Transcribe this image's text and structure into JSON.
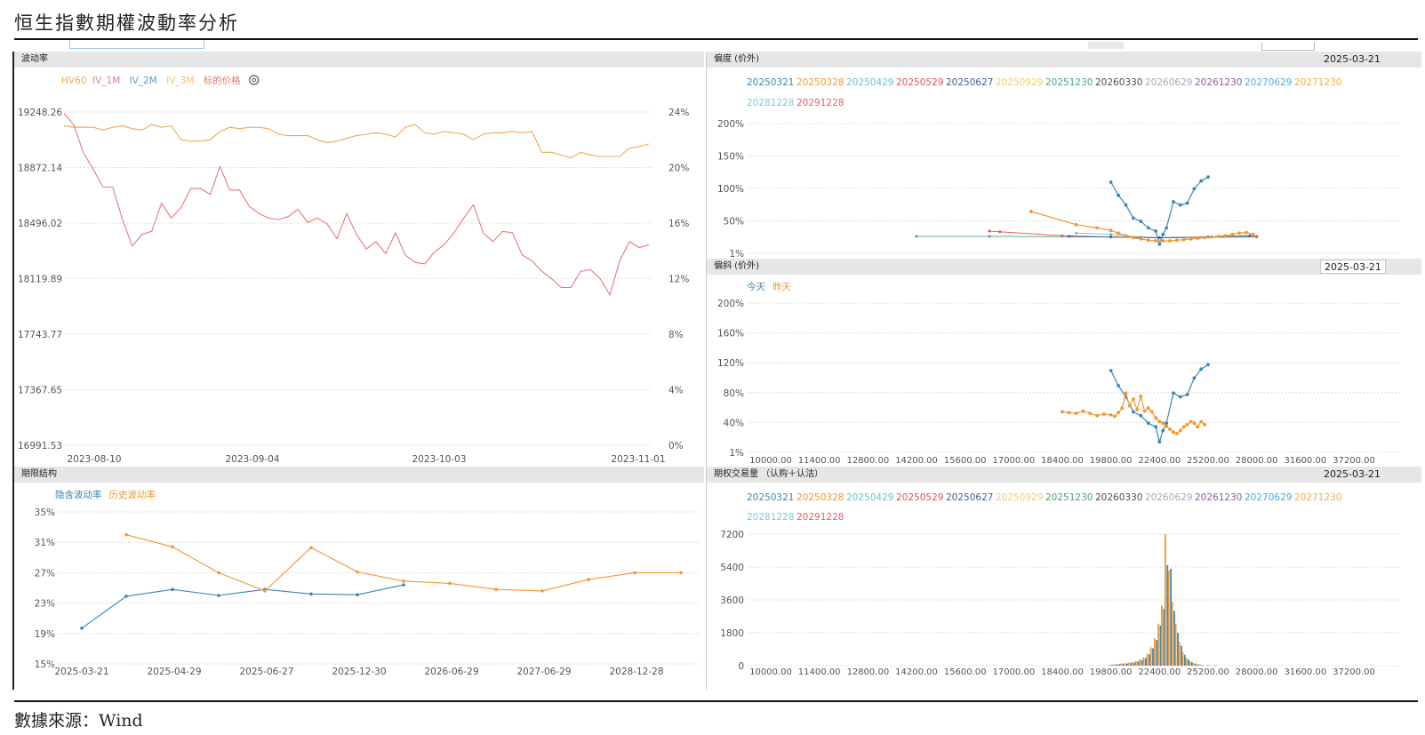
{
  "page": {
    "title": "恒生指數期權波動率分析",
    "source": "數據來源：Wind"
  },
  "colors": {
    "hv60": "#f0a850",
    "iv1m": "#e8807a",
    "iv2m": "#5b9bd5",
    "iv3m": "#f4c070",
    "price": "#e87878",
    "blue": "#3a86b5",
    "orange": "#f3962f",
    "grid": "#d0d0d0",
    "axis_text": "#555555"
  },
  "panels": {
    "vol": {
      "title": "波动率",
      "legend": [
        {
          "label": "HV60",
          "color": "#f0a850"
        },
        {
          "label": "IV_1M",
          "color": "#e8807a"
        },
        {
          "label": "IV_2M",
          "color": "#5b9bd5"
        },
        {
          "label": "IV_3M",
          "color": "#f4c070"
        },
        {
          "label": "标的价格",
          "color": "#e87878"
        }
      ],
      "settings_icon": "gear-icon"
    },
    "smile": {
      "title": "偏度 (价外)",
      "date": "2025-03-21"
    },
    "skew": {
      "title": "偏斜 (价外)",
      "date": "2025-03-21",
      "legend": [
        {
          "label": "今天",
          "color": "#3a86b5"
        },
        {
          "label": "昨天",
          "color": "#f3962f"
        }
      ]
    },
    "term": {
      "title": "期限结构",
      "legend": [
        {
          "label": "隐含波动率",
          "color": "#3a86b5"
        },
        {
          "label": "历史波动率",
          "color": "#f3962f"
        }
      ]
    },
    "volume": {
      "title": "期权交易量 （认购＋认沽）",
      "date": "2025-03-21"
    }
  },
  "expiries": [
    {
      "label": "20250321",
      "color": "#3a86b5"
    },
    {
      "label": "20250328",
      "color": "#f3962f"
    },
    {
      "label": "20250429",
      "color": "#6cc3c9"
    },
    {
      "label": "20250529",
      "color": "#e0524f"
    },
    {
      "label": "20250627",
      "color": "#405a9a"
    },
    {
      "label": "20250929",
      "color": "#f2cb6c"
    },
    {
      "label": "20251230",
      "color": "#4aa37a"
    },
    {
      "label": "20260330",
      "color": "#5a4b3c"
    },
    {
      "label": "20260629",
      "color": "#a8a8b8"
    },
    {
      "label": "20261230",
      "color": "#8a5aa8"
    },
    {
      "label": "20270629",
      "color": "#49a9d9"
    },
    {
      "label": "20271230",
      "color": "#f0b040"
    },
    {
      "label": "20281228",
      "color": "#7cc9d6"
    },
    {
      "label": "20291228",
      "color": "#e85a6a"
    }
  ],
  "strike_ticks": [
    "10000.00",
    "11400.00",
    "12800.00",
    "14200.00",
    "15600.00",
    "17000.00",
    "18400.00",
    "19800.00",
    "22400.00",
    "25200.00",
    "28000.00",
    "31600.00",
    "37200.00"
  ],
  "chart_data": [
    {
      "id": "vol",
      "type": "line",
      "x_ticks": [
        "2023-08-10",
        "2023-09-04",
        "2023-10-03",
        "2023-11-01"
      ],
      "y_left_ticks": [
        "19248.26",
        "18872.14",
        "18496.02",
        "18119.89",
        "17743.77",
        "17367.65",
        "16991.53"
      ],
      "y_right_ticks": [
        "24%",
        "20%",
        "16%",
        "12%",
        "8%",
        "4%",
        "0%"
      ],
      "y_left_range": [
        16991.53,
        19248.26
      ],
      "y_right_range": [
        0,
        24
      ],
      "series": [
        {
          "name": "HV60",
          "axis": "right",
          "values": [
            23.0,
            22.9,
            22.9,
            22.9,
            22.7,
            22.9,
            23.0,
            22.8,
            22.7,
            23.1,
            22.9,
            23.0,
            22.0,
            21.9,
            21.9,
            22.0,
            22.6,
            22.9,
            22.8,
            22.9,
            22.9,
            22.8,
            22.4,
            22.3,
            22.3,
            22.3,
            22.0,
            21.8,
            21.9,
            22.1,
            22.3,
            22.4,
            22.5,
            22.4,
            22.2,
            22.9,
            23.1,
            22.5,
            22.4,
            22.6,
            22.5,
            22.4,
            22.0,
            22.4,
            22.5,
            22.5,
            22.6,
            22.5,
            22.6,
            21.1,
            21.1,
            20.9,
            20.7,
            21.1,
            20.9,
            20.8,
            20.8,
            20.8,
            21.4,
            21.5,
            21.7
          ]
        },
        {
          "name": "标的价格",
          "axis": "left",
          "values": [
            19240,
            19160,
            18970,
            18860,
            18740,
            18740,
            18520,
            18340,
            18420,
            18440,
            18630,
            18530,
            18600,
            18730,
            18730,
            18690,
            18880,
            18720,
            18720,
            18610,
            18560,
            18530,
            18520,
            18540,
            18590,
            18500,
            18530,
            18490,
            18390,
            18560,
            18420,
            18320,
            18370,
            18290,
            18430,
            18280,
            18230,
            18220,
            18300,
            18350,
            18430,
            18530,
            18620,
            18430,
            18370,
            18440,
            18430,
            18280,
            18240,
            18170,
            18120,
            18060,
            18060,
            18170,
            18180,
            18120,
            18010,
            18240,
            18370,
            18330,
            18350
          ]
        }
      ]
    },
    {
      "id": "smile",
      "type": "line",
      "y_ticks": [
        "200%",
        "150%",
        "100%",
        "50%",
        "1%"
      ],
      "y_range": [
        1,
        200
      ],
      "series": [
        {
          "name": "20250321",
          "x": [
            19800,
            20200,
            20600,
            21000,
            21400,
            21800,
            22200,
            22400,
            22600,
            22800,
            23200,
            23600,
            24000,
            24400,
            24800,
            25200
          ],
          "values": [
            110,
            90,
            75,
            55,
            50,
            40,
            35,
            15,
            30,
            40,
            80,
            75,
            78,
            100,
            112,
            118
          ]
        },
        {
          "name": "20250328",
          "x": [
            17500,
            18800,
            19400,
            19800,
            20200,
            20600,
            21000,
            21400,
            21800,
            22200,
            22600,
            23000,
            23400,
            23800,
            24200,
            24600,
            25000,
            25400,
            25800,
            26200,
            26600,
            27000,
            27400,
            27800
          ],
          "values": [
            65,
            45,
            40,
            36,
            32,
            28,
            25,
            23,
            21,
            20,
            20,
            20,
            21,
            22,
            23,
            24,
            25,
            26,
            27,
            28,
            30,
            32,
            33,
            30
          ]
        }
      ]
    },
    {
      "id": "skew",
      "type": "line",
      "y_ticks": [
        "200%",
        "160%",
        "120%",
        "80%",
        "40%",
        "1%"
      ],
      "y_range": [
        1,
        200
      ],
      "series": [
        {
          "name": "今天",
          "x": [
            19800,
            20200,
            20600,
            21000,
            21400,
            21800,
            22200,
            22400,
            22600,
            22800,
            23200,
            23600,
            24000,
            24400,
            24800,
            25200
          ],
          "values": [
            110,
            90,
            75,
            55,
            50,
            40,
            35,
            15,
            30,
            40,
            80,
            75,
            78,
            100,
            112,
            118
          ]
        },
        {
          "name": "昨天",
          "x": [
            18400,
            18600,
            18800,
            19000,
            19200,
            19400,
            19600,
            19800,
            20000,
            20200,
            20400,
            20600,
            20800,
            21000,
            21200,
            21400,
            21600,
            21800,
            22000,
            22200,
            22400,
            22600,
            22800,
            23000,
            23200,
            23400,
            23600,
            23800,
            24000,
            24200,
            24400,
            24600,
            24800,
            25000
          ],
          "values": [
            55,
            54,
            53,
            56,
            53,
            50,
            52,
            51,
            49,
            54,
            60,
            80,
            63,
            72,
            58,
            76,
            56,
            60,
            55,
            47,
            42,
            40,
            36,
            32,
            28,
            26,
            30,
            35,
            38,
            42,
            40,
            35,
            42,
            38
          ]
        }
      ]
    },
    {
      "id": "term",
      "type": "line",
      "x_ticks": [
        "2025-03-21",
        "2025-04-29",
        "2025-06-27",
        "2025-12-30",
        "2026-06-29",
        "2027-06-29",
        "2028-12-28"
      ],
      "y_ticks": [
        "35%",
        "31%",
        "27%",
        "23%",
        "19%",
        "15%"
      ],
      "y_range": [
        15,
        35
      ],
      "series": [
        {
          "name": "隐含波动率",
          "values": [
            19.7,
            23.9,
            24.8,
            24.0,
            24.8,
            24.2,
            24.1,
            25.4
          ]
        },
        {
          "name": "历史波动率",
          "values": [
            null,
            32.0,
            30.4,
            27.0,
            24.6,
            30.3,
            27.1,
            25.9,
            25.6,
            24.8,
            24.6,
            26.1,
            27.0,
            27.0
          ]
        }
      ]
    },
    {
      "id": "volume",
      "type": "bar",
      "y_ticks": [
        "7200",
        "5400",
        "3600",
        "1800",
        "0"
      ],
      "y_range": [
        0,
        7200
      ],
      "bars": [
        {
          "x": 19800,
          "call": 60,
          "put": 40
        },
        {
          "x": 20000,
          "call": 80,
          "put": 60
        },
        {
          "x": 20200,
          "call": 100,
          "put": 80
        },
        {
          "x": 20400,
          "call": 120,
          "put": 90
        },
        {
          "x": 20600,
          "call": 140,
          "put": 110
        },
        {
          "x": 20800,
          "call": 170,
          "put": 140
        },
        {
          "x": 21000,
          "call": 200,
          "put": 170
        },
        {
          "x": 21200,
          "call": 260,
          "put": 220
        },
        {
          "x": 21400,
          "call": 340,
          "put": 300
        },
        {
          "x": 21600,
          "call": 450,
          "put": 420
        },
        {
          "x": 21800,
          "call": 650,
          "put": 620
        },
        {
          "x": 22000,
          "call": 1000,
          "put": 950
        },
        {
          "x": 22200,
          "call": 1500,
          "put": 1400
        },
        {
          "x": 22400,
          "call": 2300,
          "put": 2200
        },
        {
          "x": 22600,
          "call": 3300,
          "put": 3100
        },
        {
          "x": 22800,
          "call": 7200,
          "put": 5500
        },
        {
          "x": 23000,
          "call": 5200,
          "put": 5300
        },
        {
          "x": 23200,
          "call": 3500,
          "put": 3000
        },
        {
          "x": 23400,
          "call": 2300,
          "put": 1800
        },
        {
          "x": 23600,
          "call": 1300,
          "put": 1100
        },
        {
          "x": 23800,
          "call": 750,
          "put": 600
        },
        {
          "x": 24000,
          "call": 420,
          "put": 350
        },
        {
          "x": 24200,
          "call": 260,
          "put": 200
        },
        {
          "x": 24400,
          "call": 150,
          "put": 120
        },
        {
          "x": 24600,
          "call": 90,
          "put": 70
        },
        {
          "x": 24800,
          "call": 60,
          "put": 40
        },
        {
          "x": 25200,
          "call": 40,
          "put": 25
        },
        {
          "x": 25600,
          "call": 25,
          "put": 15
        },
        {
          "x": 28000,
          "call": 15,
          "put": 10
        }
      ]
    }
  ]
}
